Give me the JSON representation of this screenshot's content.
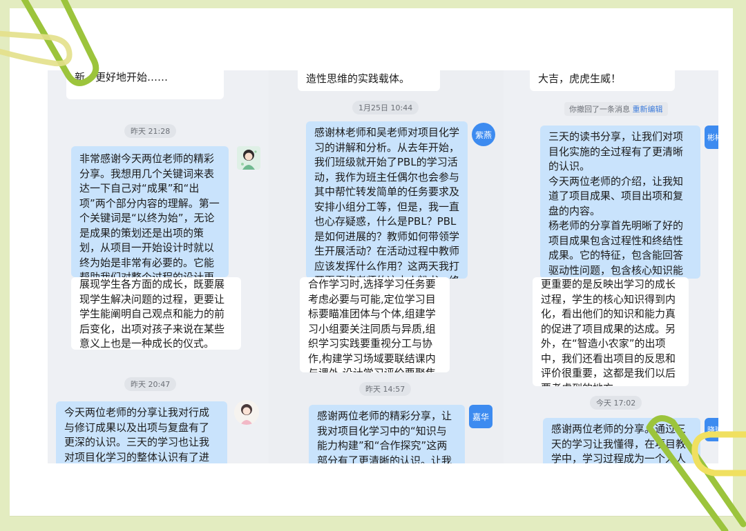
{
  "col1": {
    "top_text": "新、更好地开始……",
    "time1": "昨天 21:28",
    "msg1_part1": "非常感谢今天两位老师的精彩分享。我想用几个关键词来表达一下自己对“成果”和“出项”两个部分内容的理解。第一个关键词是“以终为始”，无论是成果的策划还是出项的策划，从项目一开始设计时就以终为始是非常有必要的。它能帮助我们对整个过程的设计更加清晰、目标更加明确。第二个关键词是“有价值”，什么是好的成果？是",
    "msg1_part2": "展现学生各方面的成长，既要展现学生解决问题的过程，更要让学生能阐明自己观点和能力的前后变化，出项对孩子来说在某些意义上也是一种成长的仪式。",
    "time2": "昨天 20:47",
    "msg2": "今天两位老师的分享让我对行成与修订成果以及出项与复盘有了更深的认识。三天的学习也让我对项目化学习的整体认识有了进一步的提"
  },
  "col2": {
    "top_text": "造性思维的实践载体。",
    "time1": "1月25日 10:44",
    "avatar1": "紫燕",
    "msg1_part1": "感谢林老师和吴老师对项目化学习的讲解和分析。从去年开始，我们班级就开始了PBL的学习活动，我作为班主任偶尔也会参与其中帮忙转发简单的任务要求及安排小组分工等，但是，我一直也心存疑惑，什么是PBL？PBL是如何进展的？教师如何带领学生开展活动？在活动过程中教师应该发挥什么作用？这两天我打开夏雪梅老师的这本小粉书，终于找到了答案。原来项目化学习就是要引导学生在真实情境",
    "msg1_part2": "合作学习时,选择学习任务要考虑必要与可能,定位学习目标要瞄准团体与个体,组建学习小组要关注同质与异质,组织学习实践要重视分工与协作,构建学习场域要联结课内与课外,设计学习评价要聚焦导向与提升.",
    "time2": "昨天 14:57",
    "avatar2": "嘉华",
    "msg2": "感谢两位老师的精彩分享，让我对项目化学习中的“知识与能力构建”和“合作探究”这两部分有了更清晰的认识。让我印"
  },
  "col3": {
    "top_text": "大吉，虎虎生威！",
    "notice_text": "你撤回了一条消息",
    "notice_link": "重新编辑",
    "avatar1": "彬彬",
    "msg1_part1": "三天的读书分享，让我们对项目化实施的全过程有了更清晰的认识。\n今天两位老师的介绍，让我知道了项目成果、项目出项和复盘的内容。\n杨老师的分享首先明晰了好的项目成果包含过程性和终结性成果。它的特征，包含能回答驱动性问题，包含核心知识能力的转化和迁移，体现创造性，包含个人和团队成果两方面。成果并不是最后才产生",
    "msg1_part2": "更重要的是反映出学习的成长过程，学生的核心知识得到内化，看出他们的知识和能力真的促进了项目成果的达成。另外，在“智造小农家”的出项中，我们还看出项目的反思和评价很重要，这都是我们以后要考虑到的地方。",
    "time2": "今天 17:02",
    "avatar2": "晓琳",
    "msg2": "感谢两位老师的分享。通过三天的学习让我懂得，在项目教学中，学习过程成为一个人人"
  },
  "colors": {
    "background": "#e3ecc0",
    "bubble_blue": "#c9e3fc",
    "avatar_blue": "#3d8bf0",
    "clip_green": "#9cc43c",
    "clip_yellow": "#f0e060"
  }
}
